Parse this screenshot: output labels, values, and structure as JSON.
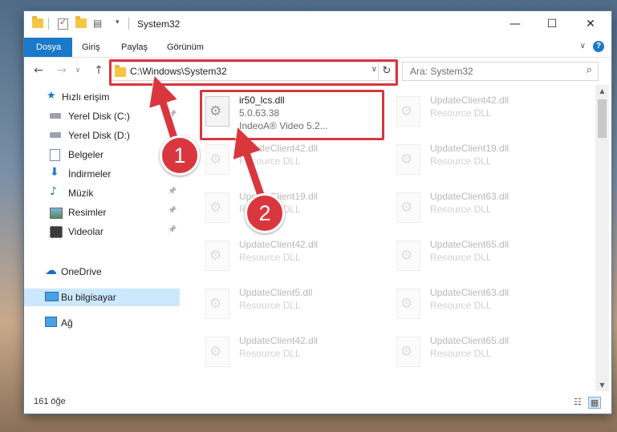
{
  "window": {
    "title": "System32",
    "minimize_glyph": "—",
    "maximize_glyph": "☐",
    "close_glyph": "✕"
  },
  "ribbon": {
    "tabs": [
      {
        "label": "Dosya"
      },
      {
        "label": "Giriş"
      },
      {
        "label": "Paylaş"
      },
      {
        "label": "Görünüm"
      }
    ],
    "help": "?",
    "expand_glyph": "∨"
  },
  "nav": {
    "back_glyph": "←",
    "forward_glyph": "→",
    "recent_glyph": "∨",
    "up_glyph": "↑",
    "address": "C:\\Windows\\System32",
    "address_drop": "∨",
    "refresh_glyph": "↻",
    "search_placeholder": "Ara: System32",
    "search_glyph": "⌕"
  },
  "sidebar": {
    "items": [
      {
        "label": "Hızlı erişim",
        "icon": "star-icon",
        "pinned": false
      },
      {
        "label": "Yerel Disk (C:)",
        "icon": "drive-icon",
        "pinned": true
      },
      {
        "label": "Yerel Disk (D:)",
        "icon": "drive-icon",
        "pinned": true
      },
      {
        "label": "Belgeler",
        "icon": "documents-icon",
        "pinned": true
      },
      {
        "label": "İndirmeler",
        "icon": "download-icon",
        "pinned": true
      },
      {
        "label": "Müzik",
        "icon": "music-icon",
        "pinned": true
      },
      {
        "label": "Resimler",
        "icon": "pictures-icon",
        "pinned": true
      },
      {
        "label": "Videolar",
        "icon": "videos-icon",
        "pinned": true
      },
      {
        "label": "OneDrive",
        "icon": "cloud-icon",
        "pinned": false
      },
      {
        "label": "Bu bilgisayar",
        "icon": "computer-icon",
        "pinned": false,
        "selected": true
      },
      {
        "label": "Ağ",
        "icon": "network-icon",
        "pinned": false
      }
    ],
    "pin_glyph": "📌"
  },
  "files": [
    {
      "name": "ir50_lcs.dll",
      "line2": "5.0.63.38",
      "line3": "IndeoA® Video 5.2...",
      "highlighted": true
    },
    {
      "name": "UpdateClient42.dll",
      "line2": "Resource DLL"
    },
    {
      "name": "UpdateClient42.dll",
      "line2": "Resource DLL"
    },
    {
      "name": "UpdateClient19.dll",
      "line2": "Resource DLL"
    },
    {
      "name": "UpdateClient19.dll",
      "line2": "Resource DLL"
    },
    {
      "name": "UpdateClient63.dll",
      "line2": "Resource DLL"
    },
    {
      "name": "UpdateClient42.dll",
      "line2": "Resource DLL"
    },
    {
      "name": "UpdateClient65.dll",
      "line2": "Resource DLL"
    },
    {
      "name": "UpdateClient5.dll",
      "line2": "Resource DLL"
    },
    {
      "name": "UpdateClient63.dll",
      "line2": "Resource DLL"
    },
    {
      "name": "UpdateClient42.dll",
      "line2": "Resource DLL"
    },
    {
      "name": "UpdateClient65.dll",
      "line2": "Resource DLL"
    }
  ],
  "status": {
    "count": "161 öğe"
  },
  "callouts": {
    "one": "1",
    "two": "2"
  },
  "colors": {
    "accent": "#1979ca",
    "highlight_red": "#d9363e",
    "selected_bg": "#cce8ff"
  }
}
